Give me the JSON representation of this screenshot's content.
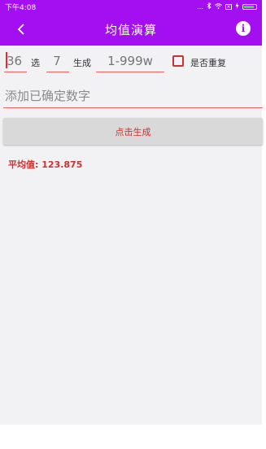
{
  "status_bar": {
    "time": "下午4:08"
  },
  "header": {
    "title": "均值演算"
  },
  "form": {
    "total_value": "36",
    "select_label": "选",
    "select_value": "7",
    "generate_label": "生成",
    "range_placeholder": "1-999w",
    "repeat_label": "是否重复",
    "confirmed_placeholder": "添加已确定数字"
  },
  "actions": {
    "generate_button": "点击生成"
  },
  "result": {
    "average_label": "平均值:",
    "average_value": "123.875"
  },
  "colors": {
    "accent": "#a30ff0",
    "alert": "#d03030",
    "battery": "#39e035"
  },
  "icons": {
    "back": "back-arrow-icon",
    "info": "info-icon"
  }
}
